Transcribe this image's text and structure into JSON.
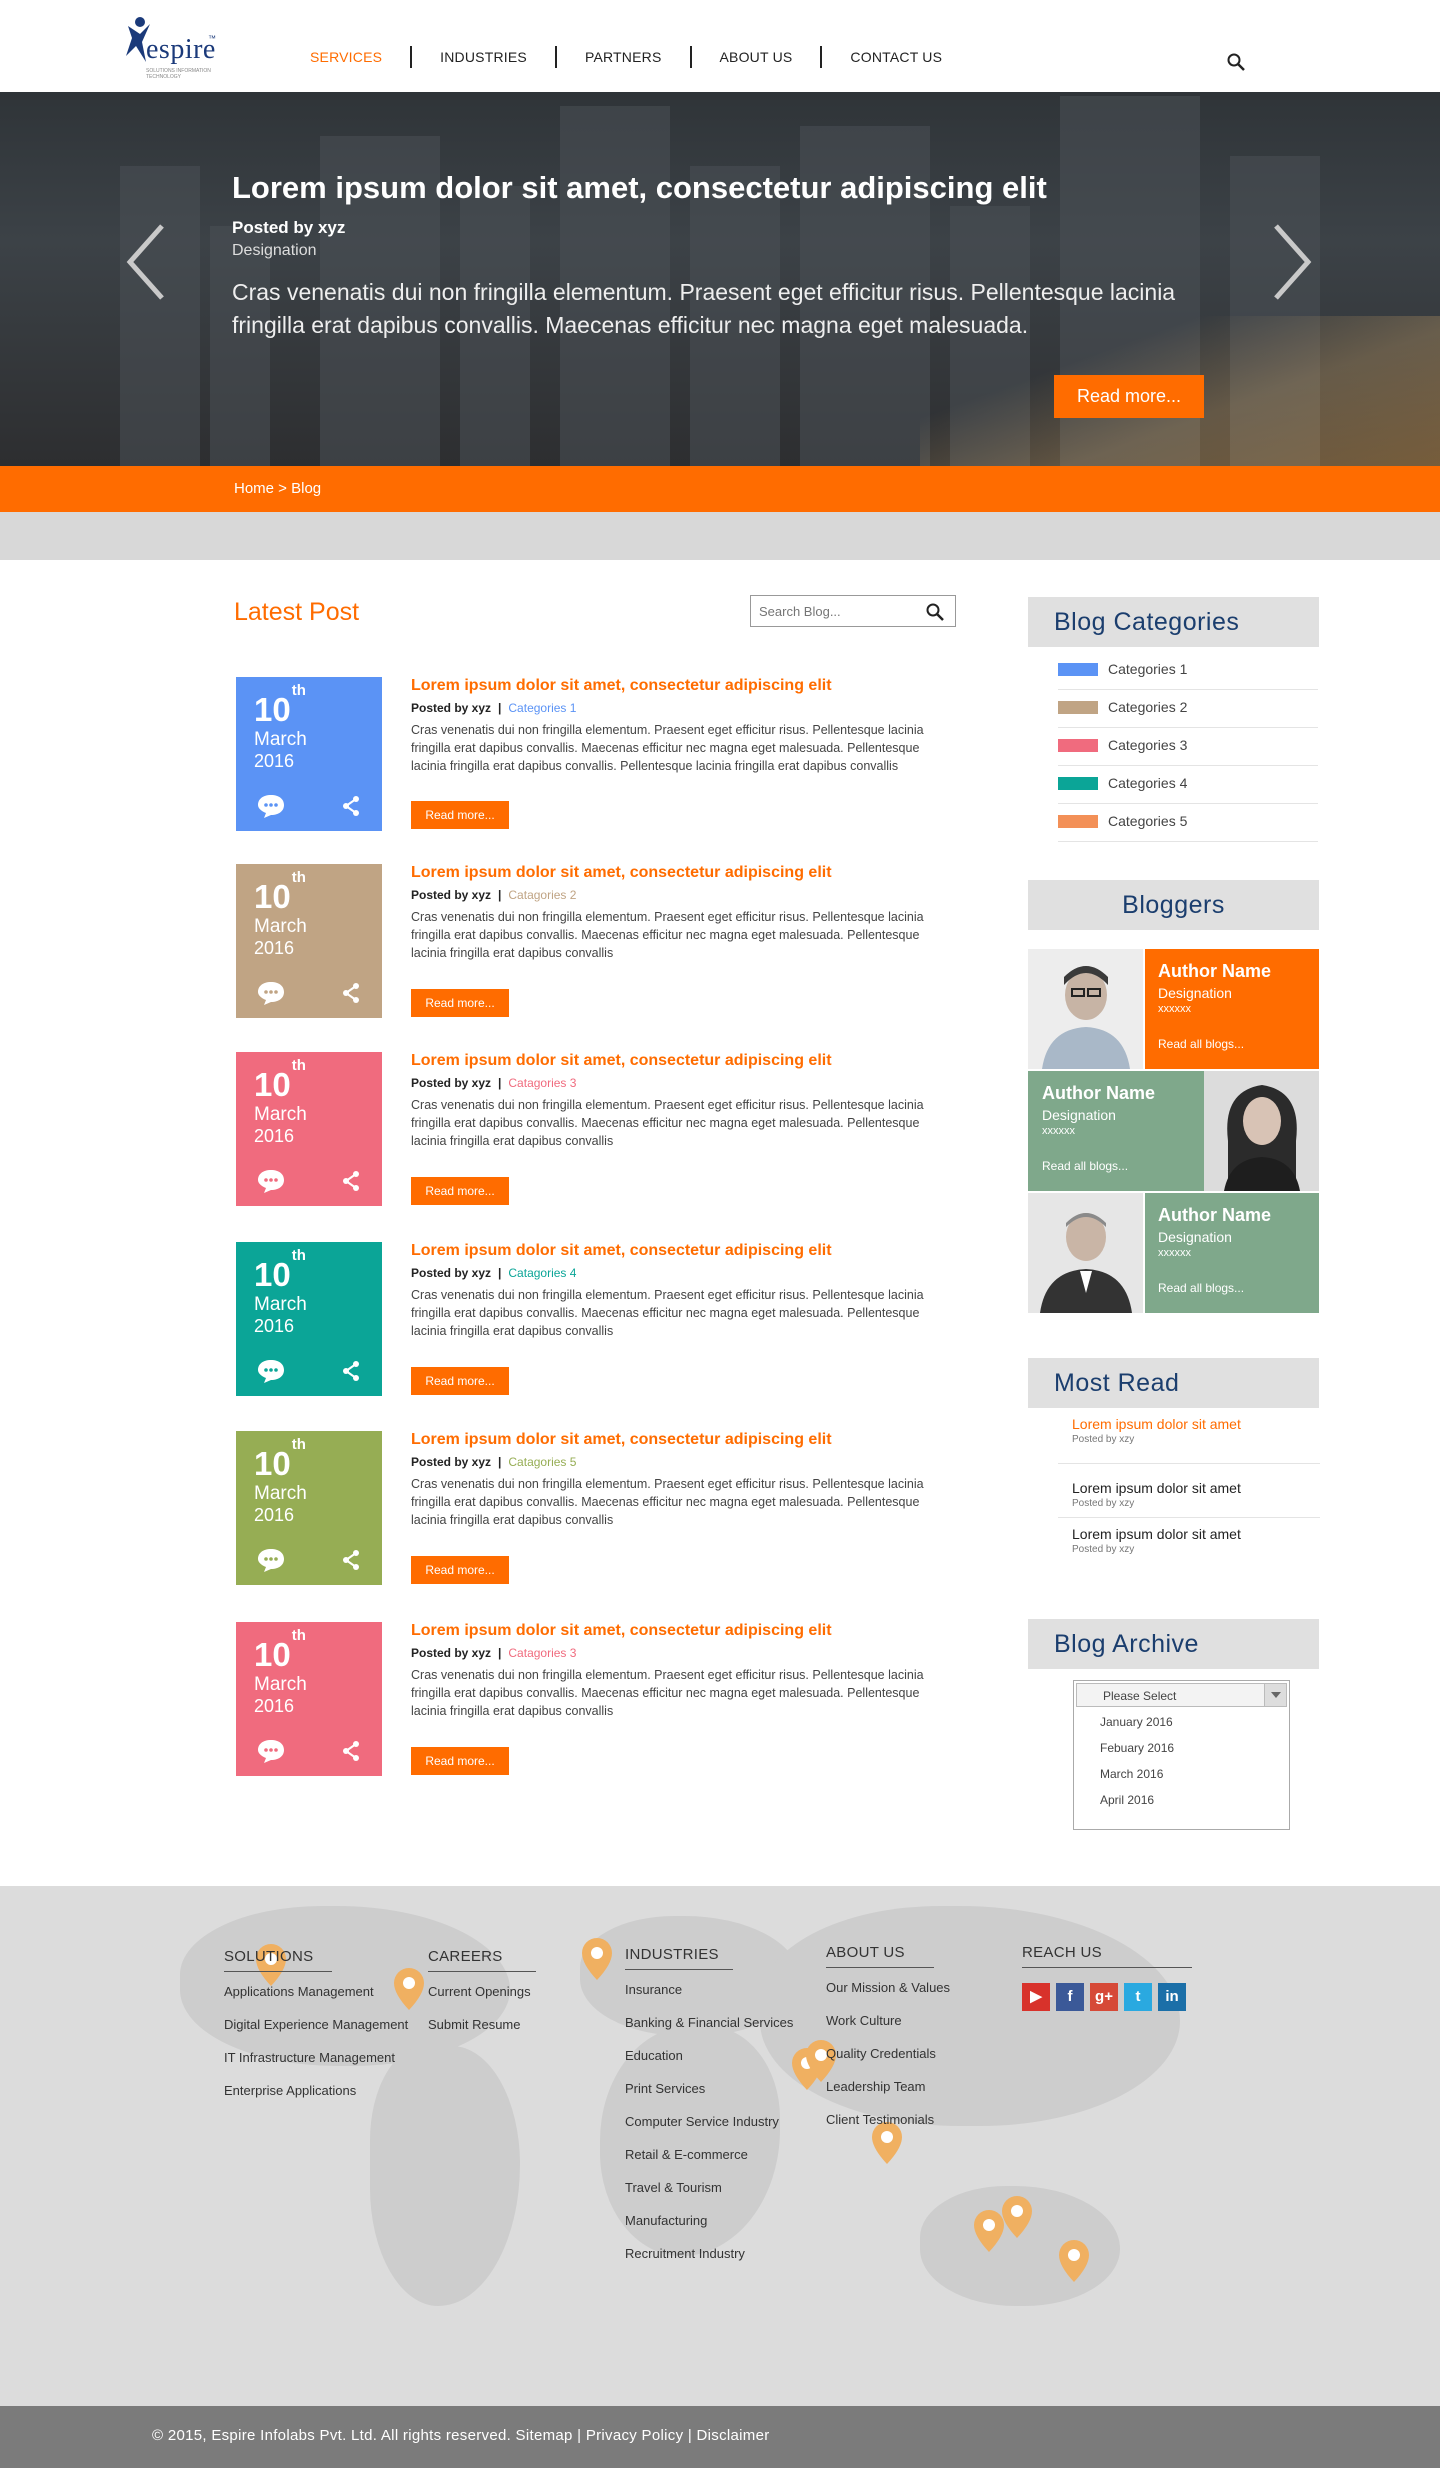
{
  "brand": {
    "logo_text": "espire",
    "tagline": "SOLUTIONS INFORMATION TECHNOLOGY"
  },
  "nav": {
    "items": [
      "SERVICES",
      "INDUSTRIES",
      "PARTNERS",
      "ABOUT US",
      "CONTACT US"
    ],
    "active": "SERVICES"
  },
  "hero": {
    "title": "Lorem ipsum dolor sit amet, consectetur adipiscing elit",
    "posted_by": "Posted by xyz",
    "designation": "Designation",
    "text": "Cras venenatis dui non fringilla elementum. Praesent eget efficitur risus. Pellentesque lacinia fringilla erat dapibus convallis. Maecenas efficitur nec magna eget malesuada.",
    "button": "Read more..."
  },
  "breadcrumb": "Home > Blog",
  "main": {
    "title": "Latest Post",
    "search_placeholder": "Search Blog...",
    "posts": [
      {
        "day": "10",
        "suffix": "th",
        "month": "March",
        "year": "2016",
        "color": "#5b93f5",
        "title": "Lorem ipsum dolor sit amet, consectetur adipiscing elit",
        "posted": "Posted by xyz",
        "category": "Categories 1",
        "cat_color": "#5b93f5",
        "body": "Cras venenatis dui non fringilla elementum. Praesent eget efficitur risus. Pellentesque lacinia fringilla erat dapibus convallis. Maecenas efficitur nec magna eget malesuada. Pellentesque lacinia fringilla erat dapibus convallis. Pellentesque lacinia fringilla erat dapibus convallis",
        "button": "Read more..."
      },
      {
        "day": "10",
        "suffix": "th",
        "month": "March",
        "year": "2016",
        "color": "#c0a484",
        "title": "Lorem ipsum dolor sit amet, consectetur adipiscing elit",
        "posted": "Posted by xyz",
        "category": "Catagories 2",
        "cat_color": "#c0a484",
        "body": "Cras venenatis dui non fringilla elementum. Praesent eget efficitur risus. Pellentesque lacinia fringilla erat dapibus convallis. Maecenas efficitur nec magna eget malesuada. Pellentesque lacinia fringilla erat dapibus convallis",
        "button": "Read more..."
      },
      {
        "day": "10",
        "suffix": "th",
        "month": "March",
        "year": "2016",
        "color": "#f06b7e",
        "title": "Lorem ipsum dolor sit amet, consectetur adipiscing elit",
        "posted": "Posted by xyz",
        "category": "Catagories 3",
        "cat_color": "#f06b7e",
        "body": "Cras venenatis dui non fringilla elementum. Praesent eget efficitur risus. Pellentesque lacinia fringilla erat dapibus convallis. Maecenas efficitur nec magna eget malesuada. Pellentesque lacinia fringilla erat dapibus convallis",
        "button": "Read more..."
      },
      {
        "day": "10",
        "suffix": "th",
        "month": "March",
        "year": "2016",
        "color": "#0ba597",
        "title": "Lorem ipsum dolor sit amet, consectetur adipiscing elit",
        "posted": "Posted by xyz",
        "category": "Catagories 4",
        "cat_color": "#0ba597",
        "body": "Cras venenatis dui non fringilla elementum. Praesent eget efficitur risus. Pellentesque lacinia fringilla erat dapibus convallis. Maecenas efficitur nec magna eget malesuada. Pellentesque lacinia fringilla erat dapibus convallis",
        "button": "Read more..."
      },
      {
        "day": "10",
        "suffix": "th",
        "month": "March",
        "year": "2016",
        "color": "#96ad54",
        "title": "Lorem ipsum dolor sit amet, consectetur adipiscing elit",
        "posted": "Posted by xyz",
        "category": "Catagories 5",
        "cat_color": "#96ad54",
        "body": "Cras venenatis dui non fringilla elementum. Praesent eget efficitur risus. Pellentesque lacinia fringilla erat dapibus convallis. Maecenas efficitur nec magna eget malesuada. Pellentesque lacinia fringilla erat dapibus convallis",
        "button": "Read more..."
      },
      {
        "day": "10",
        "suffix": "th",
        "month": "March",
        "year": "2016",
        "color": "#f06b7e",
        "title": "Lorem ipsum dolor sit amet, consectetur adipiscing elit",
        "posted": "Posted by xyz",
        "category": "Catagories 3",
        "cat_color": "#f06b7e",
        "body": "Cras venenatis dui non fringilla elementum. Praesent eget efficitur risus. Pellentesque lacinia fringilla erat dapibus convallis. Maecenas efficitur nec magna eget malesuada. Pellentesque lacinia fringilla erat dapibus convallis",
        "button": "Read more..."
      }
    ]
  },
  "sidebar": {
    "categories_title": "Blog Categories",
    "categories": [
      {
        "label": "Categories 1",
        "color": "#5b93f5"
      },
      {
        "label": "Categories 2",
        "color": "#c0a484"
      },
      {
        "label": "Categories 3",
        "color": "#f06b7e"
      },
      {
        "label": "Categories 4",
        "color": "#0ba597"
      },
      {
        "label": "Categories 5",
        "color": "#f39057"
      }
    ],
    "bloggers_title": "Bloggers",
    "bloggers": [
      {
        "name": "Author Name",
        "designation": "Designation",
        "extra": "xxxxxx",
        "link": "Read all blogs...",
        "color": "#ff6c00"
      },
      {
        "name": "Author Name",
        "designation": "Designation",
        "extra": "xxxxxx",
        "link": "Read all blogs...",
        "color": "#7fa88b"
      },
      {
        "name": "Author Name",
        "designation": "Designation",
        "extra": "xxxxxx",
        "link": "Read all blogs...",
        "color": "#7fa88b"
      }
    ],
    "most_read_title": "Most Read",
    "most_read": [
      {
        "title": "Lorem ipsum dolor sit amet",
        "posted": "Posted by xzy",
        "highlight": true
      },
      {
        "title": "Lorem ipsum dolor sit amet",
        "posted": "Posted by xzy",
        "highlight": false
      },
      {
        "title": "Lorem ipsum dolor sit amet",
        "posted": "Posted by xzy",
        "highlight": false
      }
    ],
    "archive_title": "Blog Archive",
    "archive_select": "Please Select",
    "archive_options": [
      "January 2016",
      "Febuary 2016",
      "March 2016",
      "April 2016"
    ]
  },
  "footer": {
    "columns": [
      {
        "heading": "SOLUTIONS",
        "links": [
          "Applications Management",
          "Digital Experience Management",
          "IT Infrastructure Management",
          "Enterprise Applications"
        ]
      },
      {
        "heading": "CAREERS",
        "links": [
          "Current Openings",
          "Submit Resume"
        ]
      },
      {
        "heading": "INDUSTRIES",
        "links": [
          "Insurance",
          "Banking & Financial Services",
          "Education",
          "Print Services",
          "Computer Service Industry",
          "Retail & E-commerce",
          "Travel & Tourism",
          "Manufacturing",
          "Recruitment Industry"
        ]
      },
      {
        "heading": "ABOUT US",
        "links": [
          "Our Mission & Values",
          "Work Culture",
          "Quality Credentials",
          "Leadership Team",
          "Client Testimonials"
        ]
      }
    ],
    "reach_us": "REACH US",
    "social": [
      {
        "name": "youtube-icon",
        "glyph": "▶",
        "color": "#d8322b"
      },
      {
        "name": "facebook-icon",
        "glyph": "f",
        "color": "#3b5998"
      },
      {
        "name": "googleplus-icon",
        "glyph": "g+",
        "color": "#d64937"
      },
      {
        "name": "twitter-icon",
        "glyph": "t",
        "color": "#2aa9e0"
      },
      {
        "name": "linkedin-icon",
        "glyph": "in",
        "color": "#1b6fa8"
      }
    ],
    "copyright": "© 2015, Espire Infolabs Pvt. Ltd. All rights reserved. Sitemap | Privacy Policy | Disclaimer"
  }
}
